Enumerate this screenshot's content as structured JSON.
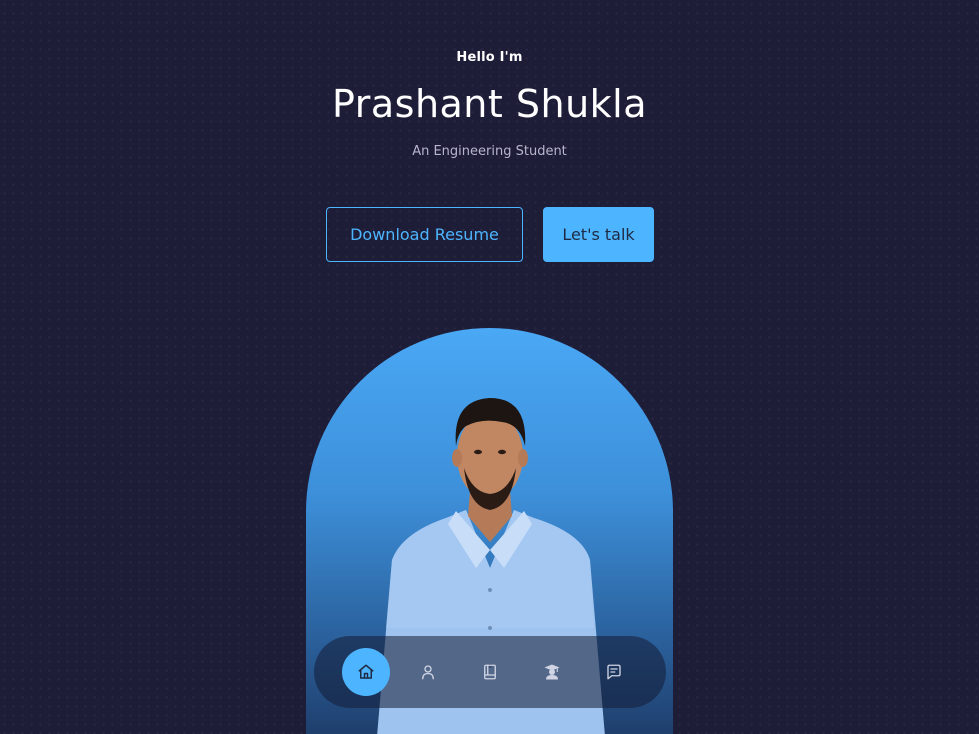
{
  "hero": {
    "greeting": "Hello I'm",
    "name": "Prashant Shukla",
    "subtitle": "An Engineering Student"
  },
  "buttons": {
    "download_label": "Download Resume",
    "talk_label": "Let's talk"
  },
  "portrait": {
    "alt": "Portrait photo of Prashant Shukla"
  },
  "nav": {
    "items": [
      {
        "icon": "home-icon",
        "active": true
      },
      {
        "icon": "user-icon",
        "active": false
      },
      {
        "icon": "book-icon",
        "active": false
      },
      {
        "icon": "graduate-icon",
        "active": false
      },
      {
        "icon": "message-icon",
        "active": false
      }
    ]
  },
  "colors": {
    "background": "#1e1d38",
    "accent": "#4db5ff",
    "text": "#ffffff",
    "muted_text": "#b7b6cc"
  }
}
